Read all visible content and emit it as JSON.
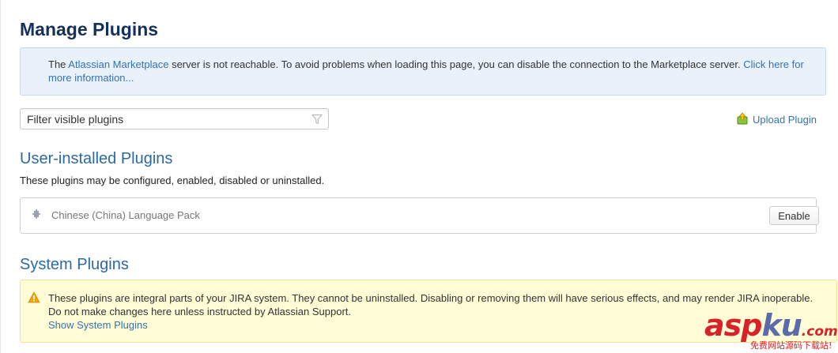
{
  "page": {
    "title": "Manage Plugins"
  },
  "info_message": {
    "text_before": "The ",
    "marketplace_link": "Atlassian Marketplace",
    "text_after": " server is not reachable. To avoid problems when loading this page, you can disable the connection to the Marketplace server. ",
    "more_info_link": "Click here for more information..."
  },
  "filter": {
    "placeholder": "Filter visible plugins",
    "value": "",
    "icon": "funnel-icon"
  },
  "upload": {
    "label": "Upload Plugin",
    "icon": "upload-plugin-icon"
  },
  "user_installed": {
    "heading": "User-installed Plugins",
    "description": "These plugins may be configured, enabled, disabled or uninstalled.",
    "plugins": [
      {
        "name": "Chinese (China) Language Pack",
        "icon": "puzzle-piece-icon",
        "action_label": "Enable"
      }
    ]
  },
  "system": {
    "heading": "System Plugins",
    "warning_text": "These plugins are integral parts of your JIRA system. They cannot be uninstalled. Disabling or removing them will have serious effects, and may render JIRA inoperable. Do not make changes here unless instructed by Atlassian Support.",
    "show_link": "Show System Plugins",
    "icon": "warning-icon"
  },
  "watermark": {
    "main_red": "asp",
    "main_blue": "ku",
    "suffix": ".com",
    "sub": "免费网站源码下载站!"
  },
  "colors": {
    "title": "#14315a",
    "heading": "#2c6aa3",
    "link": "#3572b0",
    "info_bg": "#e9f2fb",
    "warning_bg": "#fffdd6",
    "warning_icon": "#f0a30a"
  }
}
